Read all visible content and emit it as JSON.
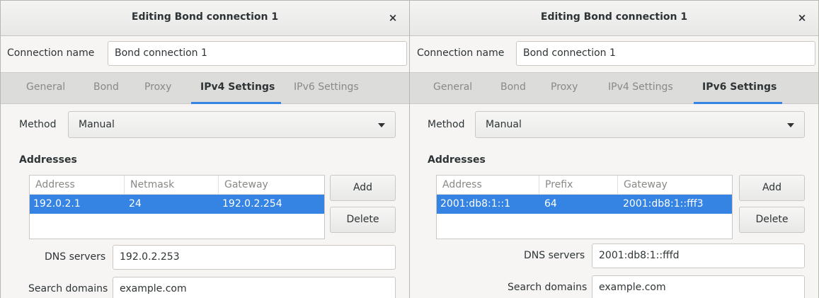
{
  "left": {
    "title": "Editing Bond connection 1",
    "close": "×",
    "connection_name_label": "Connection name",
    "connection_name_value": "Bond connection 1",
    "tabs": [
      "General",
      "Bond",
      "Proxy",
      "IPv4 Settings",
      "IPv6 Settings"
    ],
    "active_tab": "IPv4 Settings",
    "method_label": "Method",
    "method_value": "Manual",
    "addresses_title": "Addresses",
    "columns": [
      "Address",
      "Netmask",
      "Gateway"
    ],
    "row": [
      "192.0.2.1",
      "24",
      "192.0.2.254"
    ],
    "add_label": "Add",
    "delete_label": "Delete",
    "dns_label": "DNS servers",
    "dns_value": "192.0.2.253",
    "search_label": "Search domains",
    "search_value": "example.com"
  },
  "right": {
    "title": "Editing Bond connection 1",
    "close": "×",
    "connection_name_label": "Connection name",
    "connection_name_value": "Bond connection 1",
    "tabs": [
      "General",
      "Bond",
      "Proxy",
      "IPv4 Settings",
      "IPv6 Settings"
    ],
    "active_tab": "IPv6 Settings",
    "method_label": "Method",
    "method_value": "Manual",
    "addresses_title": "Addresses",
    "columns": [
      "Address",
      "Prefix",
      "Gateway"
    ],
    "row": [
      "2001:db8:1::1",
      "64",
      "2001:db8:1::fff3"
    ],
    "add_label": "Add",
    "delete_label": "Delete",
    "dns_label": "DNS servers",
    "dns_value": "2001:db8:1::fffd",
    "search_label": "Search domains",
    "search_value": "example.com"
  },
  "colors": {
    "accent": "#3584e4",
    "window_bg": "#f6f5f4",
    "tabbar_bg": "#dcdcdb"
  }
}
